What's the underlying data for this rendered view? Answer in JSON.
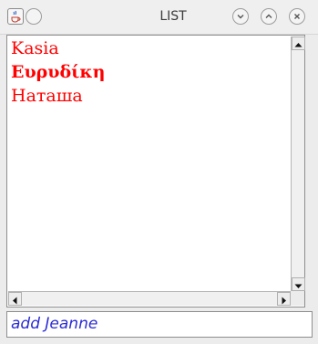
{
  "window": {
    "title": "LIST"
  },
  "list": {
    "items": [
      {
        "label": "Kasia",
        "bold": false
      },
      {
        "label": "Ευρυδίκη",
        "bold": true
      },
      {
        "label": "Наташа",
        "bold": false
      }
    ],
    "text_color": "#ff0000"
  },
  "input": {
    "value": "add Jeanne",
    "text_color": "#2b2bd6"
  },
  "icons": {
    "app": "java-cup-icon",
    "menu": "window-menu-icon",
    "minimize": "minimize-icon",
    "maximize": "maximize-icon",
    "close": "close-icon",
    "scroll_up": "arrow-up-icon",
    "scroll_down": "arrow-down-icon",
    "scroll_left": "arrow-left-icon",
    "scroll_right": "arrow-right-icon"
  }
}
